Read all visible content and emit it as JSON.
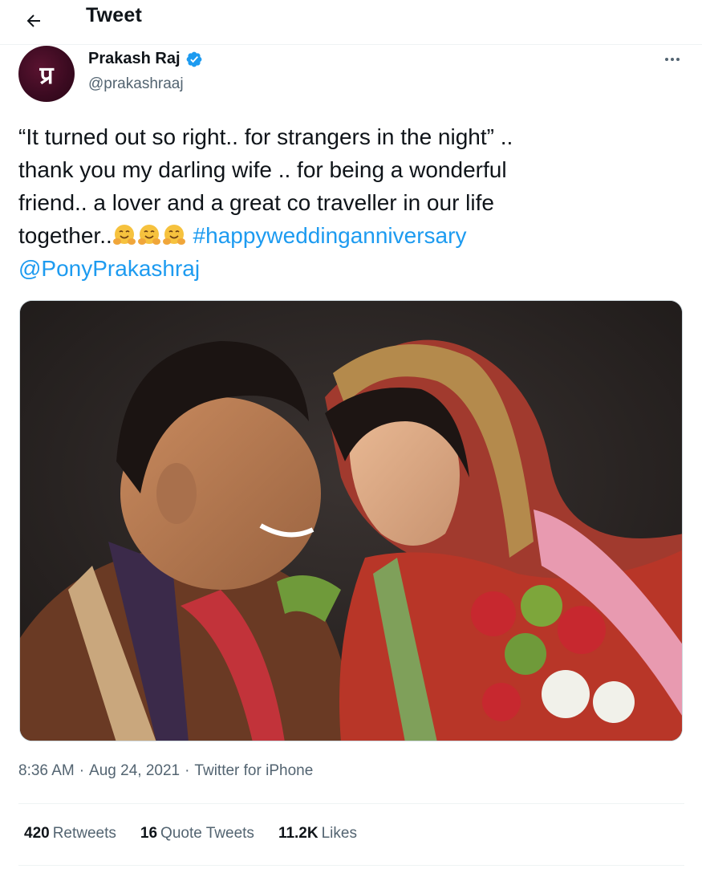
{
  "header": {
    "title": "Tweet",
    "back_icon": "arrow-left-icon"
  },
  "author": {
    "name": "Prakash Raj",
    "handle": "@prakashraaj",
    "avatar_monogram": "प्र",
    "verified": true
  },
  "tweet": {
    "lines": [
      "“It turned out so right.. for strangers in the night” ..",
      "thank you my darling wife .. for being a wonderful",
      "friend.. a lover and a great co traveller in our life"
    ],
    "line4_text": "together..",
    "emoji_name": "hugging-face-emoji",
    "emoji_count": 3,
    "hashtag": "#happyweddinganniversary",
    "mention": "@PonyPrakashraj"
  },
  "meta": {
    "time": "8:36 AM",
    "date": "Aug 24, 2021",
    "source": "Twitter for iPhone"
  },
  "stats": {
    "retweets_count": "420",
    "retweets_label": "Retweets",
    "quote_count": "16",
    "quote_label": "Quote Tweets",
    "likes_count": "11.2K",
    "likes_label": "Likes"
  },
  "colors": {
    "link": "#1d9bf0",
    "secondary": "#536471",
    "text": "#0f1419"
  }
}
